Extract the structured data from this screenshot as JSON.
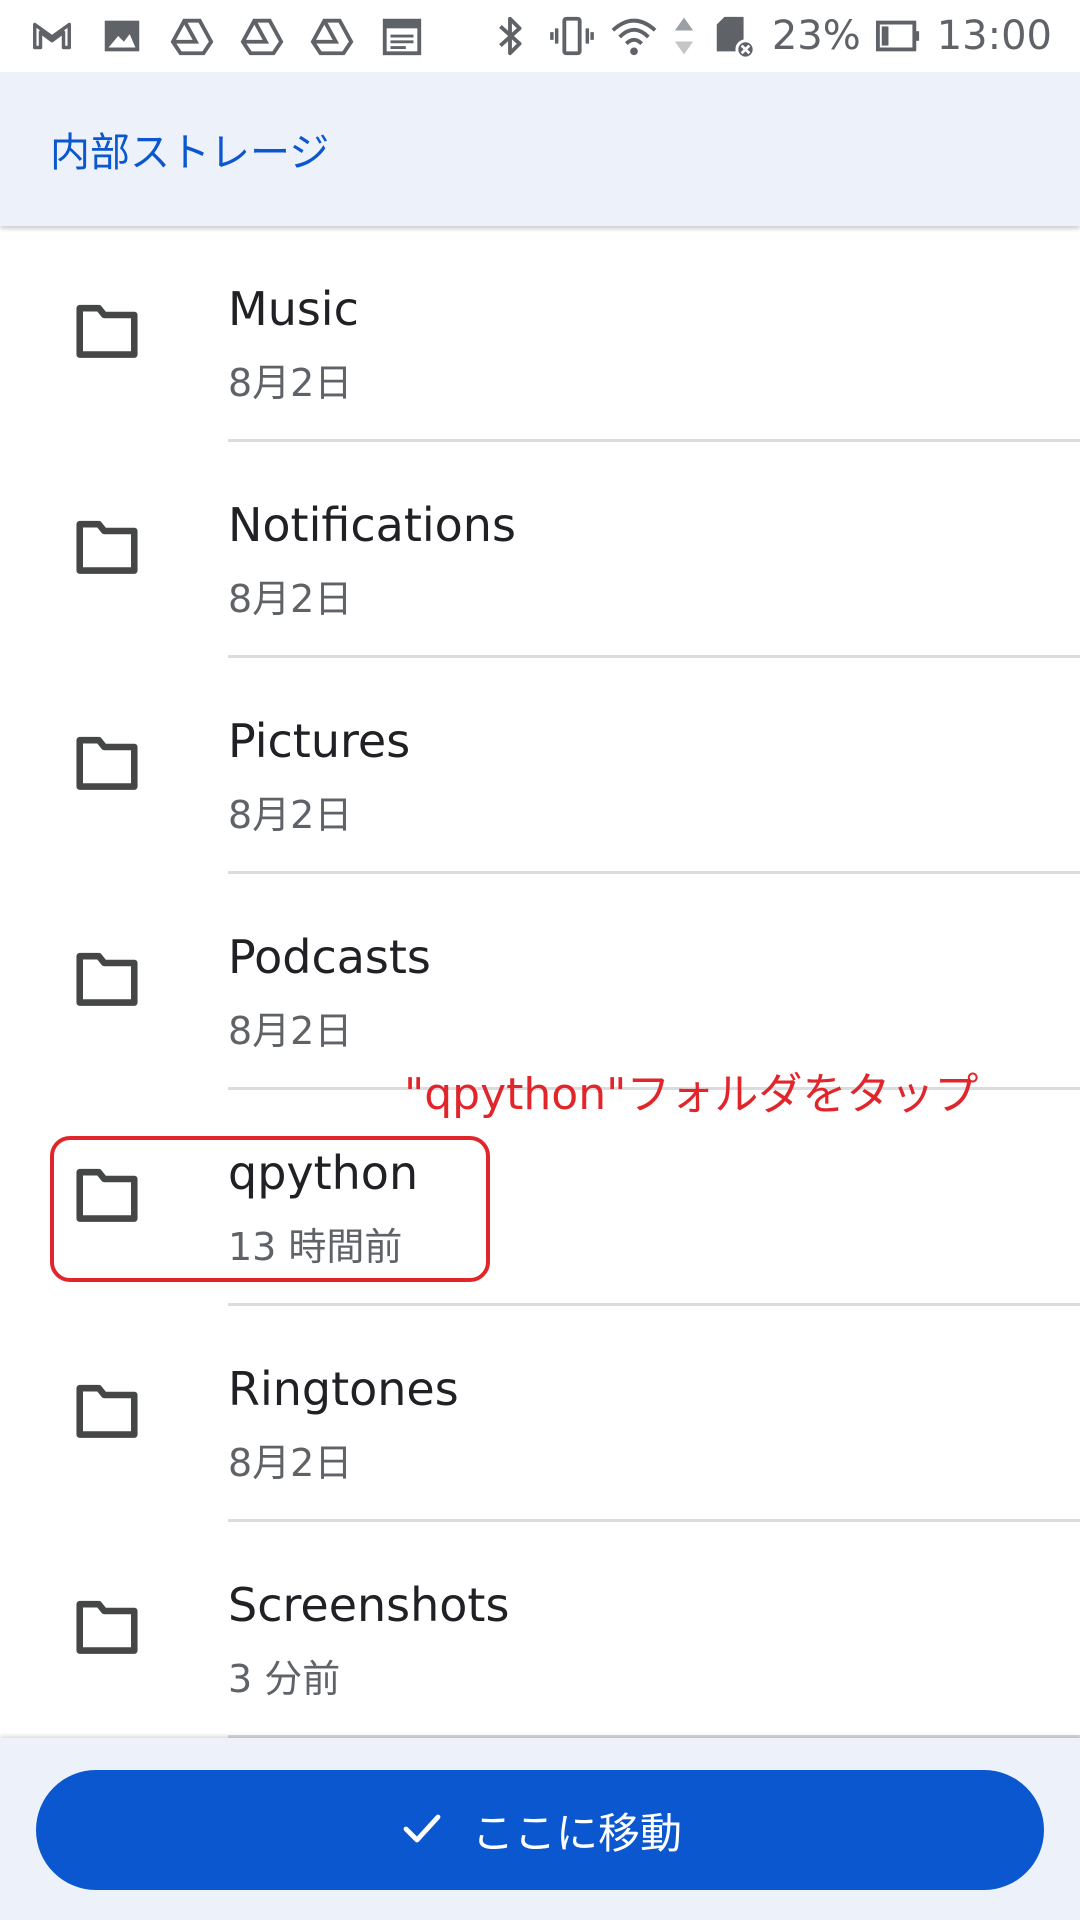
{
  "status_bar": {
    "left_icons": [
      "gmail-icon",
      "gallery-icon",
      "drive-icon",
      "drive-icon",
      "drive-icon",
      "calendar-icon"
    ],
    "right_icons": [
      "bluetooth-icon",
      "vibrate-icon",
      "wifi-icon",
      "sd-card-icon"
    ],
    "battery_percent": "23%",
    "time": "13:00"
  },
  "header": {
    "title": "内部ストレージ"
  },
  "folders": [
    {
      "name": "Music",
      "date": "8月2日"
    },
    {
      "name": "Notifications",
      "date": "8月2日"
    },
    {
      "name": "Pictures",
      "date": "8月2日"
    },
    {
      "name": "Podcasts",
      "date": "8月2日"
    },
    {
      "name": "qpython",
      "date": "13 時間前"
    },
    {
      "name": "Ringtones",
      "date": "8月2日"
    },
    {
      "name": "Screenshots",
      "date": "3 分前"
    }
  ],
  "annotation": {
    "text": "\"qpython\"フォルダをタップ"
  },
  "bottom": {
    "move_button_label": "ここに移動"
  },
  "colors": {
    "accent": "#0b57d0",
    "header_bg": "#edf2fa",
    "annotation_red": "#e0262b"
  }
}
